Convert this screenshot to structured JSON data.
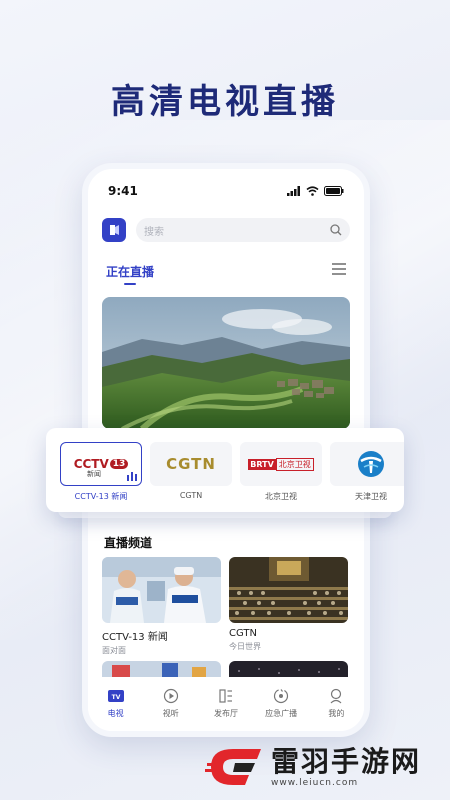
{
  "headline": "高清电视直播",
  "status": {
    "time": "9:41"
  },
  "search": {
    "placeholder": "搜索"
  },
  "tabs": {
    "live": "正在直播"
  },
  "section": {
    "live_channels": "直播频道"
  },
  "channels": [
    {
      "label": "CCTV-13 新闻",
      "logo_main": "CCTV",
      "logo_num": "13",
      "logo_sub": "新闻",
      "active": true
    },
    {
      "label": "CGTN",
      "logo_main": "CGTN"
    },
    {
      "label": "北京卫视",
      "logo_tag": "BRTV",
      "logo_text": "北京卫视"
    },
    {
      "label": "天津卫视"
    }
  ],
  "cards": [
    {
      "title": "CCTV-13 新闻",
      "subtitle": "面对面"
    },
    {
      "title": "CGTN",
      "subtitle": "今日世界"
    }
  ],
  "tabbar": [
    {
      "label": "电视",
      "icon": "tv-icon",
      "active": true
    },
    {
      "label": "视听",
      "icon": "play-circle-icon"
    },
    {
      "label": "发布厅",
      "icon": "grid-doc-icon"
    },
    {
      "label": "应急广播",
      "icon": "broadcast-icon"
    },
    {
      "label": "我的",
      "icon": "profile-icon"
    }
  ],
  "footer": {
    "brand": "雷羽手游网",
    "url": "www.leiucn.com"
  },
  "colors": {
    "accent": "#3341c6",
    "headline": "#1e2a78"
  }
}
